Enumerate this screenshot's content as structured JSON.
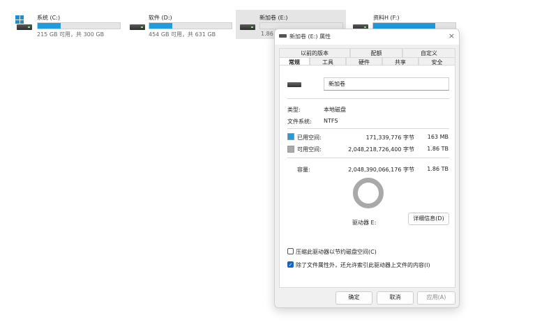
{
  "explorer": {
    "drives": [
      {
        "name": "系统 (C:)",
        "size_text": "215 GB 可用，共 300 GB",
        "used_fraction": 0.28,
        "selected": false
      },
      {
        "name": "软件 (D:)",
        "size_text": "454 GB 可用，共 631 GB",
        "used_fraction": 0.28,
        "selected": false
      },
      {
        "name": "新加卷 (E:)",
        "size_text": "1.86",
        "used_fraction": 0.0,
        "selected": true
      },
      {
        "name": "资料H (F:)",
        "size_text": "",
        "used_fraction": 0.75,
        "selected": false
      }
    ]
  },
  "dialog": {
    "title": "新加卷 (E:) 属性",
    "close_glyph": "×",
    "tabs_top": [
      "以前的版本",
      "配额",
      "自定义"
    ],
    "tabs_bottom": [
      "常规",
      "工具",
      "硬件",
      "共享",
      "安全"
    ],
    "active_tab": "常规",
    "volume_name": "新加卷",
    "type_label": "类型:",
    "type_value": "本地磁盘",
    "fs_label": "文件系统:",
    "fs_value": "NTFS",
    "used_label": "已用空间:",
    "used_bytes": "171,339,776 字节",
    "used_human": "163 MB",
    "free_label": "可用空间:",
    "free_bytes": "2,048,218,726,400 字节",
    "free_human": "1.86 TB",
    "capacity_label": "容量:",
    "capacity_bytes": "2,048,390,066,176 字节",
    "capacity_human": "1.86 TB",
    "drive_label": "驱动器 E:",
    "details_button": "详细信息(D)",
    "compress_label": "压缩此驱动器以节约磁盘空间(C)",
    "compress_checked": false,
    "index_label": "除了文件属性外，还允许索引此驱动器上文件的内容(I)",
    "index_checked": true,
    "ok_button": "确定",
    "cancel_button": "取消",
    "apply_button": "应用(A)",
    "colors": {
      "used": "#1f9bde",
      "free": "#a9a9a9",
      "accent": "#1565c0"
    }
  }
}
